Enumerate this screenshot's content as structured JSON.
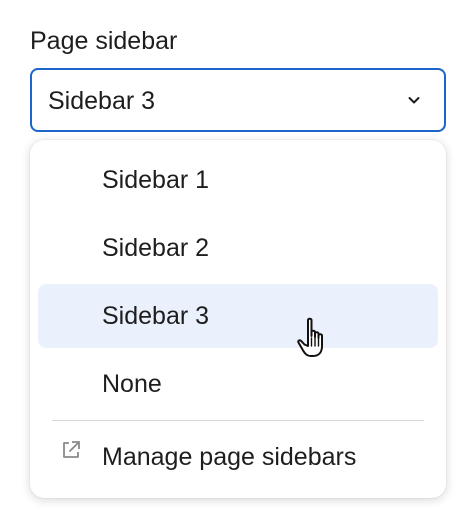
{
  "field": {
    "label": "Page sidebar",
    "selected_value": "Sidebar 3"
  },
  "menu": {
    "options": [
      {
        "label": "Sidebar 1"
      },
      {
        "label": "Sidebar 2"
      },
      {
        "label": "Sidebar 3",
        "selected": true
      },
      {
        "label": "None"
      }
    ],
    "manage_label": "Manage page sidebars"
  },
  "icons": {
    "dropdown": "chevron-down-icon",
    "manage": "external-link-icon",
    "pointer": "hand-pointer-cursor-icon"
  },
  "colors": {
    "focus_border": "#1a66c9",
    "selected_background": "#eaf1fc"
  }
}
